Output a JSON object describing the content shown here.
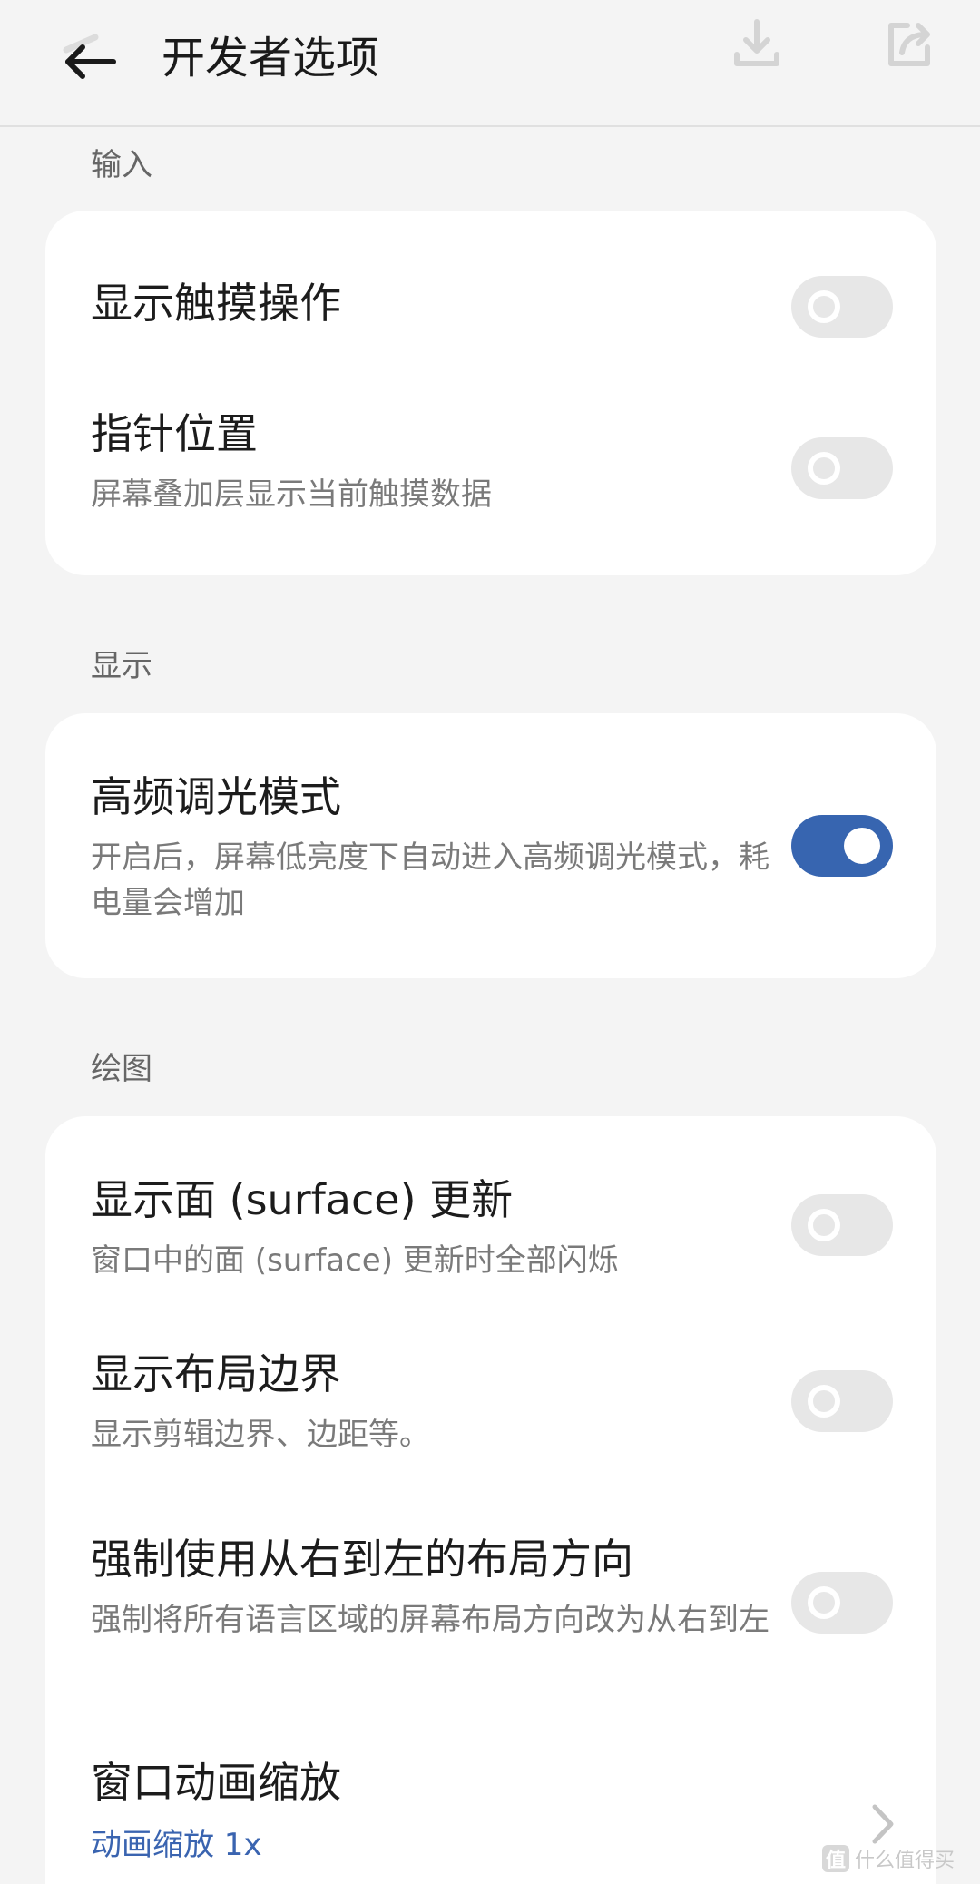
{
  "header": {
    "title": "开发者选项",
    "back_icon": "back-arrow-icon",
    "download_icon": "download-icon",
    "share_icon": "share-icon"
  },
  "sections": {
    "input": {
      "label": "输入",
      "rows": [
        {
          "title": "显示触摸操作",
          "subtitle": "",
          "toggle_on": false
        },
        {
          "title": "指针位置",
          "subtitle": "屏幕叠加层显示当前触摸数据",
          "toggle_on": false
        }
      ]
    },
    "display": {
      "label": "显示",
      "rows": [
        {
          "title": "高频调光模式",
          "subtitle": "开启后，屏幕低亮度下自动进入高频调光模式，耗电量会增加",
          "toggle_on": true
        }
      ]
    },
    "drawing": {
      "label": "绘图",
      "rows": [
        {
          "title": "显示面 (surface) 更新",
          "subtitle": "窗口中的面 (surface) 更新时全部闪烁",
          "toggle_on": false
        },
        {
          "title": "显示布局边界",
          "subtitle": "显示剪辑边界、边距等。",
          "toggle_on": false
        },
        {
          "title": "强制使用从右到左的布局方向",
          "subtitle": "强制将所有语言区域的屏幕布局方向改为从右到左",
          "toggle_on": false
        },
        {
          "title": "窗口动画缩放",
          "subtitle": "动画缩放 1x",
          "chevron_icon": "chevron-right-icon"
        }
      ]
    }
  },
  "watermark": {
    "badge": "值",
    "text": "什么值得买"
  },
  "colors": {
    "accent": "#3765b0",
    "background": "#f4f4f4",
    "card": "#ffffff",
    "toggle_off": "#e7e7e7"
  }
}
